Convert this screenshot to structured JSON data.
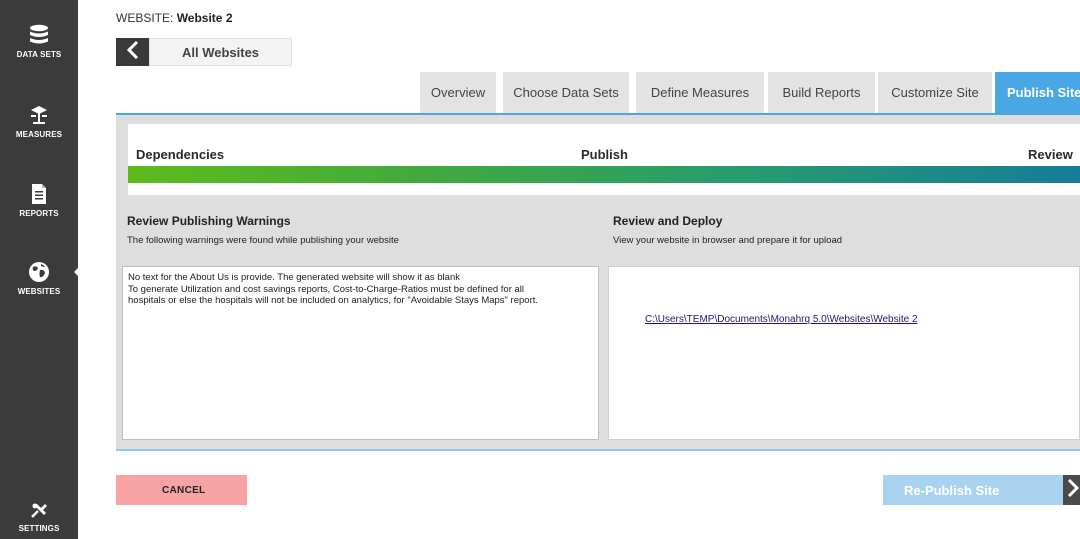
{
  "sidebar": {
    "items": [
      {
        "label": "DATA SETS",
        "icon": "database-icon"
      },
      {
        "label": "MEASURES",
        "icon": "measures-icon"
      },
      {
        "label": "REPORTS",
        "icon": "document-icon"
      },
      {
        "label": "WEBSITES",
        "icon": "globe-icon",
        "active": true
      },
      {
        "label": "SETTINGS",
        "icon": "settings-icon"
      }
    ]
  },
  "header": {
    "website_label": "WEBSITE:",
    "website_name": "Website 2",
    "back_label": "All Websites"
  },
  "tabs": [
    {
      "label": "Overview"
    },
    {
      "label": "Choose Data Sets"
    },
    {
      "label": "Define Measures"
    },
    {
      "label": "Build Reports"
    },
    {
      "label": "Customize Site"
    },
    {
      "label": "Publish Site",
      "active": true
    }
  ],
  "steps": {
    "dependencies": "Dependencies",
    "publish": "Publish",
    "review": "Review"
  },
  "warnings": {
    "title": "Review Publishing Warnings",
    "subtitle": "The following warnings were found while publishing your website",
    "lines": [
      "No text for the About Us is provide. The generated website will show it as blank",
      "To generate Utilization and cost savings reports, Cost-to-Charge-Ratios must be defined for all",
      "hospitals or else the hospitals will not be included on analytics, for \"Avoidable Stays Maps\" report."
    ]
  },
  "deploy": {
    "title": "Review and Deploy",
    "subtitle": "View your website in browser and prepare it for upload",
    "path": "C:\\Users\\TEMP\\Documents\\Monahrq 5.0\\Websites\\Website 2"
  },
  "footer": {
    "cancel_label": "CANCEL",
    "republish_label": "Re-Publish Site"
  },
  "colors": {
    "sidebar": "#3b3b3b",
    "accent": "#4aa7e6",
    "cancel": "#f8a3a3",
    "republish": "#a9d2ef"
  }
}
